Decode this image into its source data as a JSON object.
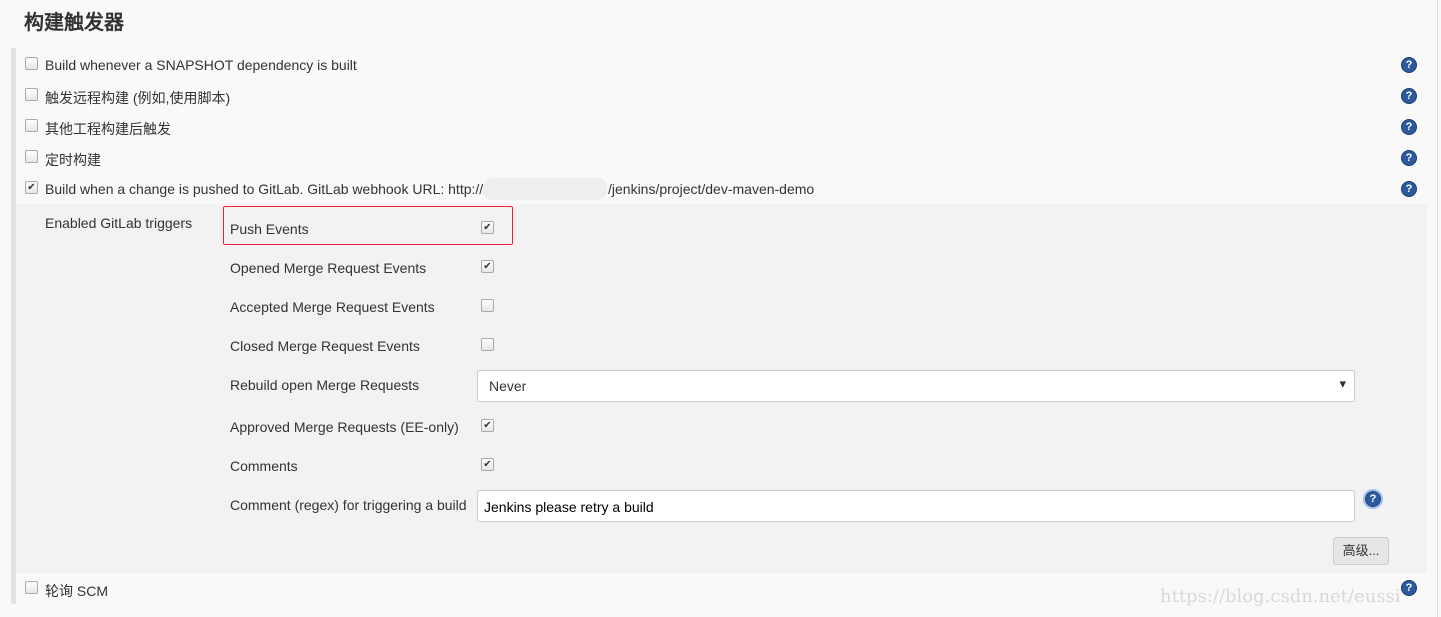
{
  "section_title": "构建触发器",
  "triggers": [
    {
      "label": "Build whenever a SNAPSHOT dependency is built",
      "checked": false
    },
    {
      "label": "触发远程构建 (例如,使用脚本)",
      "checked": false
    },
    {
      "label": "其他工程构建后触发",
      "checked": false
    },
    {
      "label": "定时构建",
      "checked": false
    },
    {
      "label": "Build when a change is pushed to GitLab. GitLab webhook URL: http://",
      "url_suffix": "/jenkins/project/dev-maven-demo",
      "checked": true
    }
  ],
  "gitlab": {
    "label": "Enabled GitLab triggers",
    "options": [
      {
        "label": "Push Events",
        "checked": true
      },
      {
        "label": "Opened Merge Request Events",
        "checked": true
      },
      {
        "label": "Accepted Merge Request Events",
        "checked": false
      },
      {
        "label": "Closed Merge Request Events",
        "checked": false
      }
    ],
    "rebuild_label": "Rebuild open Merge Requests",
    "rebuild_value": "Never",
    "approved": {
      "label": "Approved Merge Requests (EE-only)",
      "checked": true
    },
    "comments": {
      "label": "Comments",
      "checked": true
    },
    "regex_label": "Comment (regex) for triggering a build",
    "regex_value": "Jenkins please retry a build",
    "advanced_button": "高级..."
  },
  "poll_scm": {
    "label": "轮询 SCM",
    "checked": false
  },
  "watermark": "https://blog.csdn.net/eussi",
  "help_icon": "?",
  "check_glyph": "✔",
  "dropdown_glyph": "▾"
}
